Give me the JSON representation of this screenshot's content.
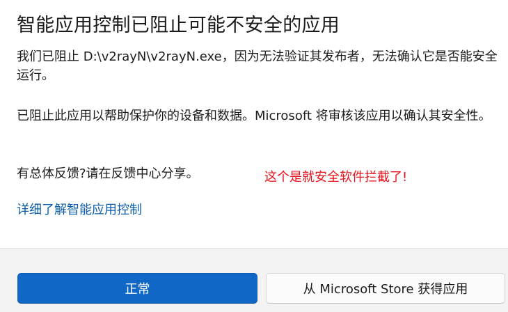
{
  "dialog": {
    "title": "智能应用控制已阻止可能不安全的应用",
    "paragraph1": "我们已阻止 D:\\v2rayN\\v2rayN.exe，因为无法验证其发布者，无法确认它是否能安全运行。",
    "paragraph2": "已阻止此应用以帮助保护你的设备和数据。Microsoft 将审核该应用以确认其安全性。",
    "feedback": "有总体反馈?请在反馈中心分享。",
    "annotation": "这个是就安全软件拦截了!",
    "learn_more_link": "详细了解智能应用控制"
  },
  "buttons": {
    "primary_label": "正常",
    "secondary_label": "从 Microsoft Store 获得应用"
  },
  "colors": {
    "primary_button": "#1167c6",
    "link": "#0a5ca8",
    "annotation": "#e8101a",
    "footer_bg": "#f3f3f3"
  }
}
